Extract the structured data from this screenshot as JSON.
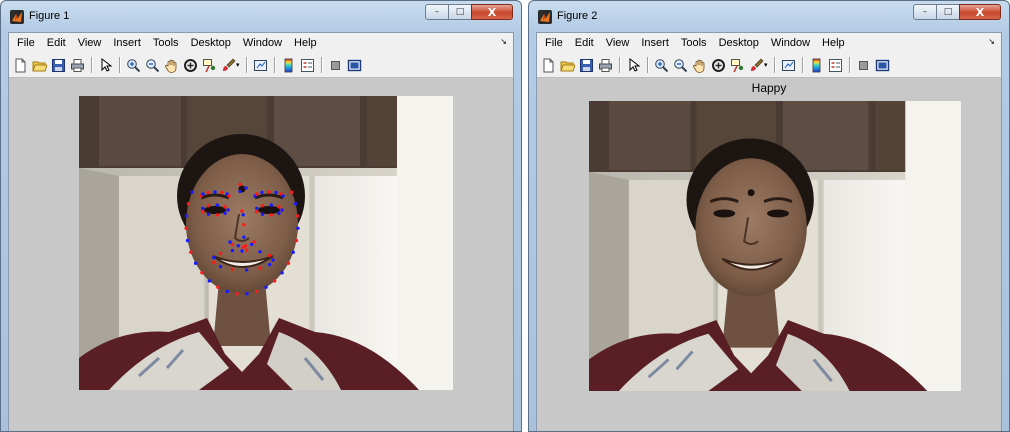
{
  "windows": [
    {
      "title": "Figure 1",
      "axes_title": "",
      "photo": "webcam-face-with-landmarks",
      "landmark_colors": [
        "#ff1a1a",
        "#1a1aff"
      ]
    },
    {
      "title": "Figure 2",
      "axes_title": "Happy",
      "photo": "webcam-face"
    }
  ],
  "menu": [
    "File",
    "Edit",
    "View",
    "Insert",
    "Tools",
    "Desktop",
    "Window",
    "Help"
  ],
  "caption_buttons": {
    "minimize": "–",
    "maximize": "□",
    "close": "X"
  },
  "toolbar_icons": [
    "new-figure-icon",
    "open-file-icon",
    "save-icon",
    "print-icon",
    "select-arrow-icon",
    "zoom-in-icon",
    "zoom-out-icon",
    "pan-hand-icon",
    "rotate-3d-icon",
    "data-cursor-icon",
    "brush-icon",
    "link-plot-icon",
    "colorbar-icon",
    "legend-icon",
    "hide-plot-tools-icon",
    "show-plot-tools-icon"
  ],
  "colors": {
    "window_frame": "#b3cbe4",
    "figure_bg": "#c8c8c8",
    "menu_bg": "#f0f0f0",
    "close_button": "#c9462c"
  }
}
